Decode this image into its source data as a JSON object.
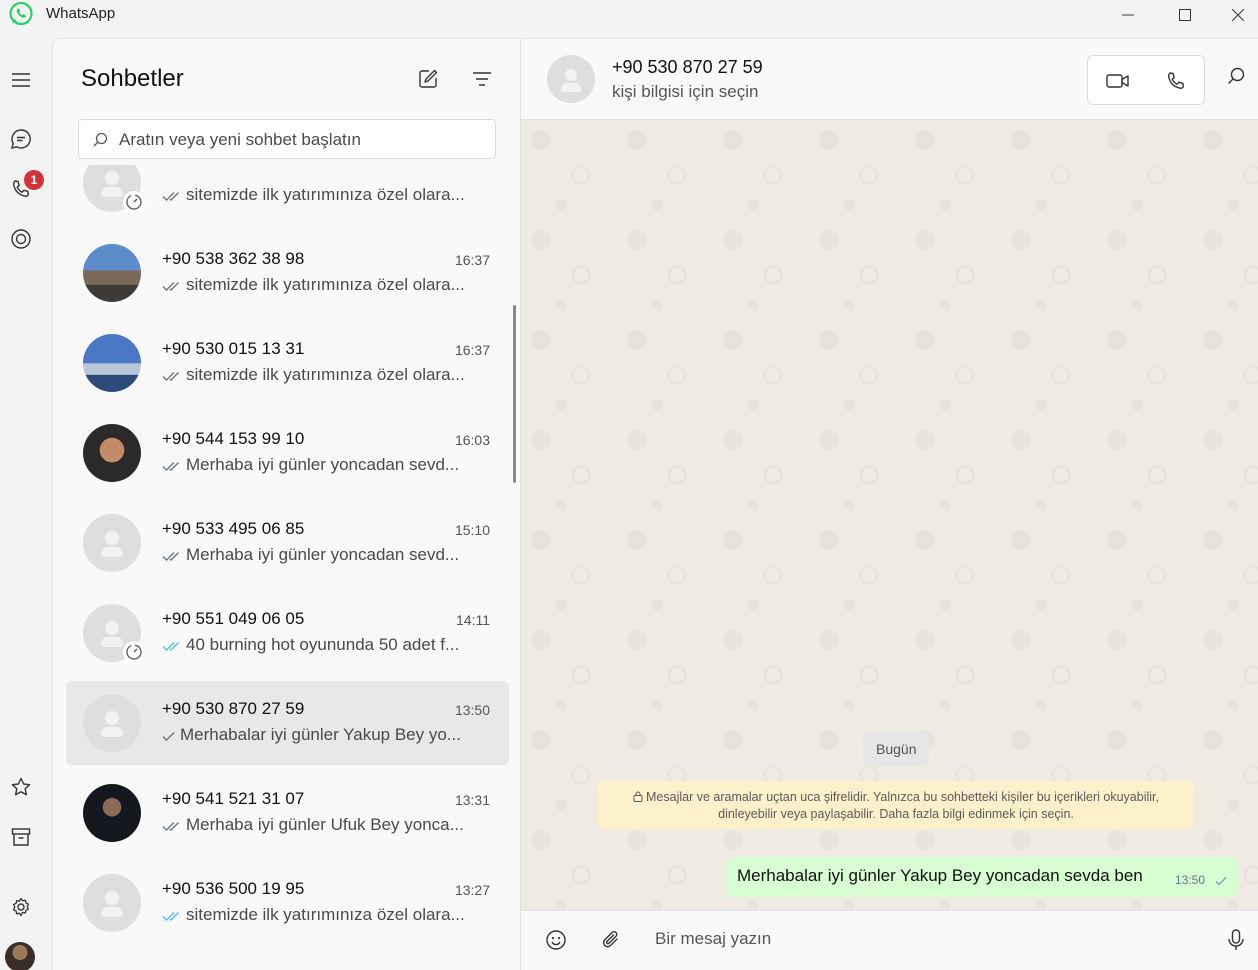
{
  "app": {
    "title": "WhatsApp",
    "logo_icon": "whatsapp-logo-icon",
    "brand_color": "#25d366"
  },
  "window_controls": [
    "minimize-icon",
    "maximize-icon",
    "close-icon"
  ],
  "rail": {
    "top": [
      "menu-icon",
      "chats-icon",
      "calls-icon",
      "status-icon"
    ],
    "calls_badge": "1",
    "bottom": [
      "starred-icon",
      "archive-icon",
      "settings-icon",
      "profile-avatar"
    ]
  },
  "chat_list": {
    "title": "Sohbetler",
    "search_placeholder": "Aratın veya yeni sohbet başlatın",
    "chats": [
      {
        "name": "",
        "time": "",
        "preview": "sitemizde ilk yatırımınıza özel olara...",
        "ticks": "double-grey",
        "timer": true
      },
      {
        "name": "+90 538 362 38 98",
        "time": "16:37",
        "preview": "sitemizde ilk yatırımınıza özel olara...",
        "ticks": "double-grey"
      },
      {
        "name": "+90 530 015 13 31",
        "time": "16:37",
        "preview": "sitemizde ilk yatırımınıza özel olara...",
        "ticks": "double-grey"
      },
      {
        "name": "+90 544 153 99 10",
        "time": "16:03",
        "preview": "Merhaba iyi günler yoncadan sevd...",
        "ticks": "double-grey"
      },
      {
        "name": "+90 533 495 06 85",
        "time": "15:10",
        "preview": "Merhaba iyi günler yoncadan sevd...",
        "ticks": "double-grey"
      },
      {
        "name": "+90 551 049 06 05",
        "time": "14:11",
        "preview": "40 burning hot oyununda 50 adet f...",
        "ticks": "double-blue",
        "timer": true
      },
      {
        "name": "+90 530 870 27 59",
        "time": "13:50",
        "preview": "Merhabalar iyi günler  Yakup Bey yo...",
        "ticks": "single-grey",
        "selected": true
      },
      {
        "name": "+90 541 521 31 07",
        "time": "13:31",
        "preview": "Merhaba iyi günler Ufuk Bey yonca...",
        "ticks": "double-grey"
      },
      {
        "name": "+90 536 500 19 95",
        "time": "13:27",
        "preview": "sitemizde ilk yatırımınıza özel olara...",
        "ticks": "double-blue"
      }
    ]
  },
  "conversation": {
    "name": "+90 530 870 27 59",
    "subtitle": "kişi bilgisi için seçin",
    "date_chip": "Bugün",
    "encryption_note": "Mesajlar ve aramalar uçtan uca şifrelidir. Yalnızca bu sohbetteki kişiler bu içerikleri okuyabilir, dinleyebilir veya paylaşabilir. Daha fazla bilgi edinmek için seçin.",
    "messages": [
      {
        "text": "Merhabalar iyi günler  Yakup Bey yoncadan sevda ben",
        "time": "13:50",
        "status": "sent"
      }
    ],
    "composer_placeholder": "Bir mesaj yazın"
  },
  "colors": {
    "outgoing_bubble": "#d9fdd3",
    "read_tick": "#53bdeb",
    "badge": "#d13438",
    "encryption_bg": "#fdf1cc"
  }
}
